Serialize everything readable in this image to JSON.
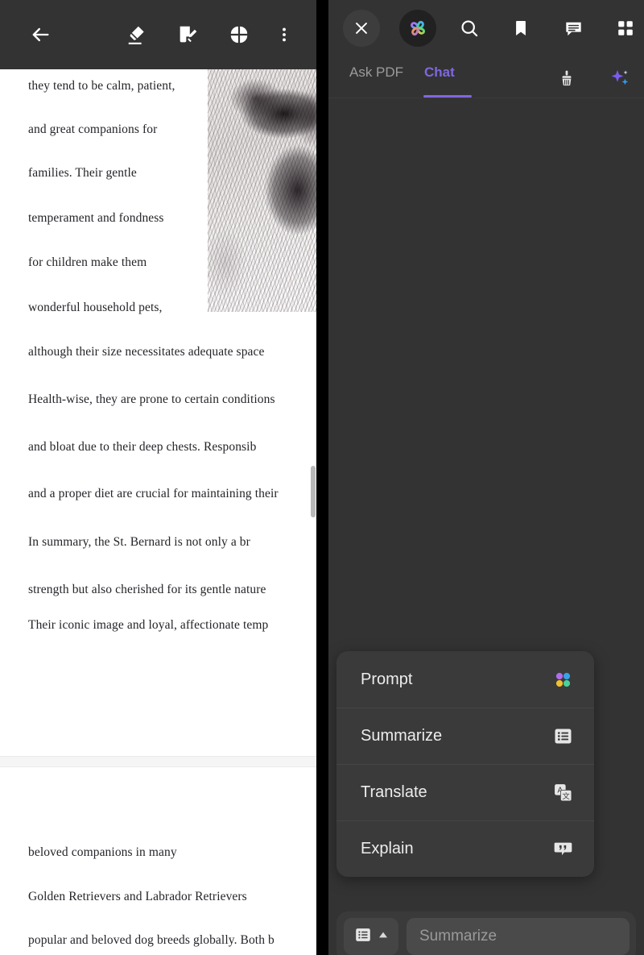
{
  "pdf_toolbar": {
    "back_label": "back-arrow",
    "icons": [
      {
        "name": "back-arrow-icon",
        "label": "Back"
      },
      {
        "name": "highlighter-icon",
        "label": "Highlight"
      },
      {
        "name": "note-edit-icon",
        "label": "Annotate"
      },
      {
        "name": "grid-four-icon",
        "label": "Pages"
      },
      {
        "name": "more-vertical-icon",
        "label": "More options"
      }
    ]
  },
  "document": {
    "page1_lines": [
      "they tend to be calm, patient,",
      "and  great  companions  for",
      "families.     Their     gentle",
      "temperament  and  fondness",
      "for   children   make   them",
      "wonderful  household  pets,",
      "although their size necessitates adequate space",
      "Health-wise, they are prone to certain conditions",
      "and bloat due to their deep chests. Responsib",
      "and a proper diet are crucial for maintaining their",
      "In  summary,  the  St.  Bernard  is  not  only  a  br",
      "strength but also cherished for its gentle nature",
      "Their iconic image and loyal, affectionate temp"
    ],
    "page2_lines": [
      "beloved        companions        in        many",
      "Golden  Retrievers  and  Labrador  Retrievers",
      "popular and beloved dog breeds globally. Both b"
    ],
    "image_alt": "St. Bernard dog close-up photograph"
  },
  "chat_panel": {
    "header_icons": [
      {
        "name": "close-icon",
        "label": "Close"
      },
      {
        "name": "ai-assistant-logo-icon",
        "label": "AI Assistant"
      },
      {
        "name": "search-icon",
        "label": "Search"
      },
      {
        "name": "bookmark-icon",
        "label": "Bookmark"
      },
      {
        "name": "comment-icon",
        "label": "Comments"
      },
      {
        "name": "grid-apps-icon",
        "label": "Apps"
      }
    ],
    "tabs": [
      {
        "label": "Ask PDF",
        "active": false
      },
      {
        "label": "Chat",
        "active": true
      }
    ],
    "tab_tools": [
      {
        "name": "broom-clear-icon",
        "label": "Clear chat"
      },
      {
        "name": "sparkle-ai-icon",
        "label": "AI magic"
      }
    ],
    "accent_color": "#8067e0",
    "body_text": ""
  },
  "action_menu": {
    "items": [
      {
        "label": "Prompt",
        "icon": "four-color-dots-icon"
      },
      {
        "label": "Summarize",
        "icon": "list-summary-icon"
      },
      {
        "label": "Translate",
        "icon": "translate-icon"
      },
      {
        "label": "Explain",
        "icon": "quote-bubble-icon"
      }
    ]
  },
  "composer": {
    "mode_icon": "list-summary-icon",
    "caret_icon": "chevron-up-icon",
    "input_value": "",
    "input_placeholder": "Summarize"
  },
  "colors": {
    "panel_bg": "#333333",
    "card_bg": "#3a3a3a",
    "accent": "#8067e0",
    "toolbar_bg": "#333333",
    "page_bg": "#ffffff"
  }
}
